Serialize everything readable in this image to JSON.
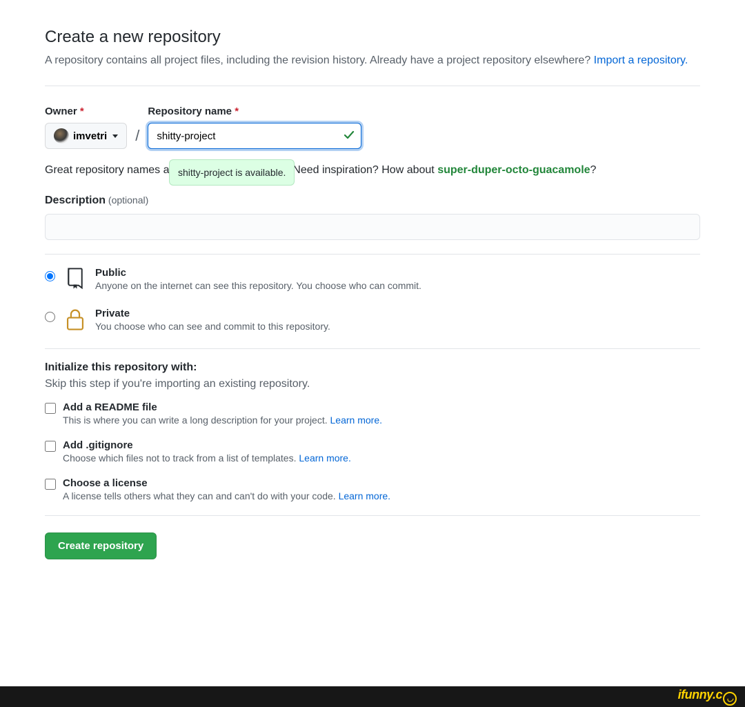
{
  "header": {
    "title": "Create a new repository",
    "subtitle_pre": "A repository contains all project files, including the revision history. Already have a project repository elsewhere? ",
    "import_link": "Import a repository."
  },
  "owner": {
    "label": "Owner",
    "username": "imvetri"
  },
  "repo": {
    "label": "Repository name",
    "value": "shitty-project",
    "tooltip": "shitty-project is available.",
    "hint_pre": "Great repository names are short and memorable. Need inspiration? How about ",
    "suggestion": "super-duper-octo-guacamole",
    "hint_suffix": "?"
  },
  "description": {
    "label": "Description",
    "optional": "(optional)",
    "value": ""
  },
  "visibility": {
    "public": {
      "title": "Public",
      "desc": "Anyone on the internet can see this repository. You choose who can commit."
    },
    "private": {
      "title": "Private",
      "desc": "You choose who can see and commit to this repository."
    }
  },
  "initialize": {
    "title": "Initialize this repository with:",
    "subtitle": "Skip this step if you're importing an existing repository.",
    "readme": {
      "title": "Add a README file",
      "desc": "This is where you can write a long description for your project. ",
      "link": "Learn more."
    },
    "gitignore": {
      "title": "Add .gitignore",
      "desc": "Choose which files not to track from a list of templates. ",
      "link": "Learn more."
    },
    "license": {
      "title": "Choose a license",
      "desc": "A license tells others what they can and can't do with your code. ",
      "link": "Learn more."
    }
  },
  "submit": {
    "label": "Create repository"
  },
  "watermark": "ifunny.c"
}
